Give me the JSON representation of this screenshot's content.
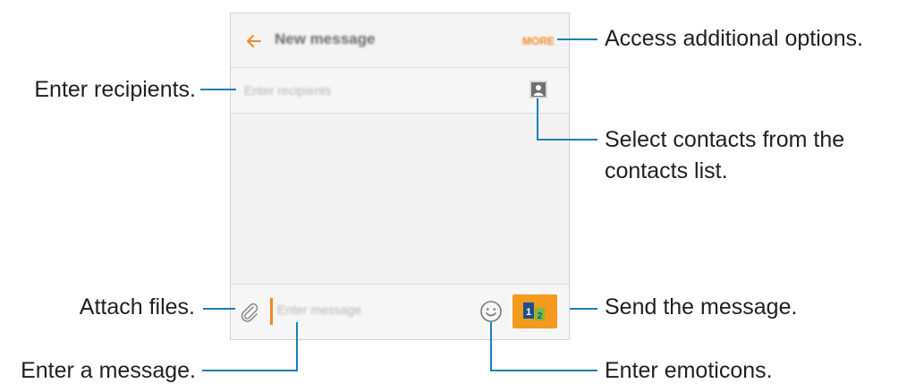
{
  "screen": {
    "header": {
      "back_icon": "arrow-left-icon",
      "title": "New message",
      "more_label": "MORE"
    },
    "recipients": {
      "placeholder": "Enter recipients",
      "contacts_icon": "contact-card-icon"
    },
    "composer": {
      "attach_icon": "paperclip-icon",
      "placeholder": "Enter message",
      "emoticon_icon": "smiley-icon",
      "send_icon": "send-sim-icon",
      "send_sim_1": "1",
      "send_sim_2": "2"
    }
  },
  "callouts": {
    "more": "Access additional options.",
    "recipients": "Enter recipients.",
    "contacts_line1": "Select contacts from the",
    "contacts_line2": "contacts list.",
    "attach": "Attach files.",
    "send": "Send the message.",
    "message": "Enter a message.",
    "emoticons": "Enter emoticons."
  },
  "colors": {
    "accent": "#f39a1f",
    "leader_line": "#1e7fb8",
    "text": "#231f20"
  }
}
